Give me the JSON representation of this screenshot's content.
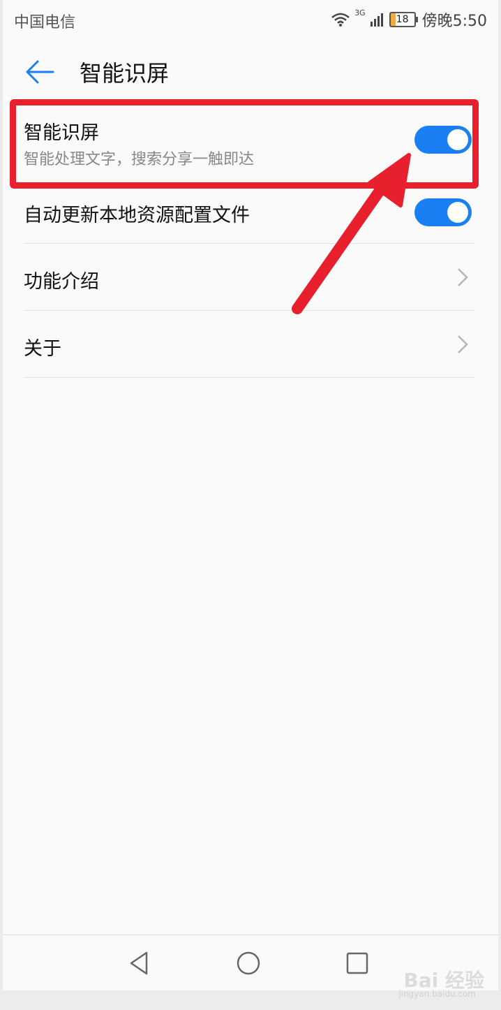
{
  "status_bar": {
    "carrier": "中国电信",
    "network": "3G",
    "battery": "18",
    "time": "傍晚5:50"
  },
  "app_bar": {
    "title": "智能识屏",
    "back_icon": "arrow-left-icon"
  },
  "settings": [
    {
      "title": "智能识屏",
      "subtitle": "智能处理文字，搜索分享一触即达",
      "control": "toggle",
      "on": true
    },
    {
      "title": "自动更新本地资源配置文件",
      "control": "toggle",
      "on": true
    },
    {
      "title": "功能介绍",
      "control": "chevron"
    },
    {
      "title": "关于",
      "control": "chevron"
    }
  ],
  "nav_bar": {
    "back_icon": "triangle-back-icon",
    "home_icon": "circle-home-icon",
    "recents_icon": "square-recents-icon"
  },
  "annotation": {
    "highlight_color": "#e8202e"
  },
  "watermark": {
    "text": "Bai 经验",
    "url": "jingyan.baidu.com"
  },
  "colors": {
    "accent": "#1a7ff2",
    "background": "#fafafa"
  }
}
